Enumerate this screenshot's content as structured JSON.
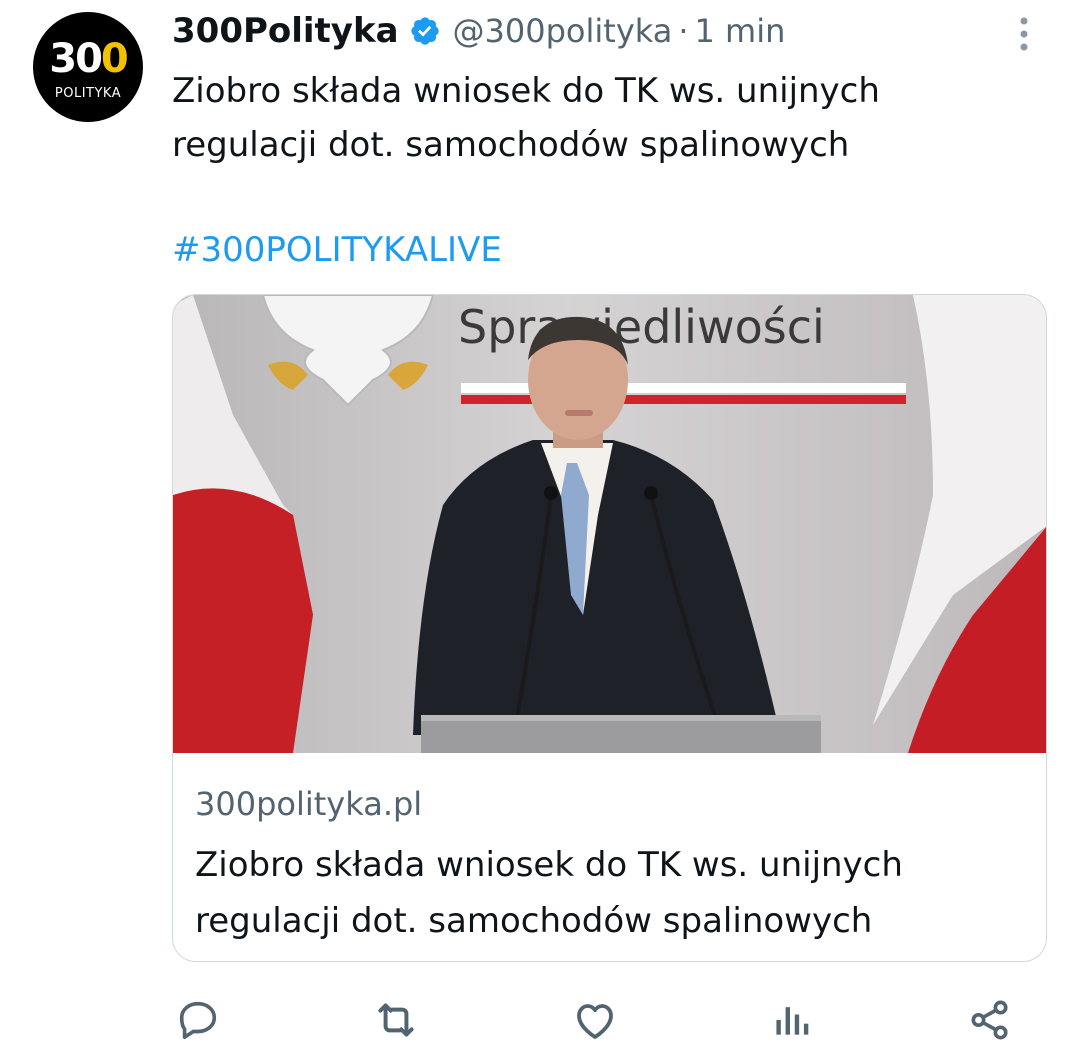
{
  "author": {
    "avatar": {
      "number_part1": "3",
      "number_part2": "0",
      "number_part3": "0",
      "subtitle": "POLITYKA"
    },
    "name": "300Polityka",
    "handle": "@300polityka",
    "separator": "·",
    "time": "1 min"
  },
  "tweet": {
    "text": "Ziobro składa wniosek do TK ws. unijnych regulacji dot. samochodów spalinowych",
    "hashtag": "#300POLITYKALIVE"
  },
  "card": {
    "image_text": "Sprawiedliwości",
    "domain": "300polityka.pl",
    "title": "Ziobro składa wniosek do TK ws. unijnych regulacji dot. samochodów spalinowych"
  },
  "actions": [
    {
      "icon": "reply-icon"
    },
    {
      "icon": "retweet-icon"
    },
    {
      "icon": "like-icon"
    },
    {
      "icon": "views-icon"
    },
    {
      "icon": "share-icon"
    }
  ],
  "colors": {
    "accent": "#1d9bf0",
    "secondary_text": "#536471",
    "primary_text": "#0f1419",
    "avatar_bg": "#000000",
    "avatar_highlight": "#f2c200"
  }
}
